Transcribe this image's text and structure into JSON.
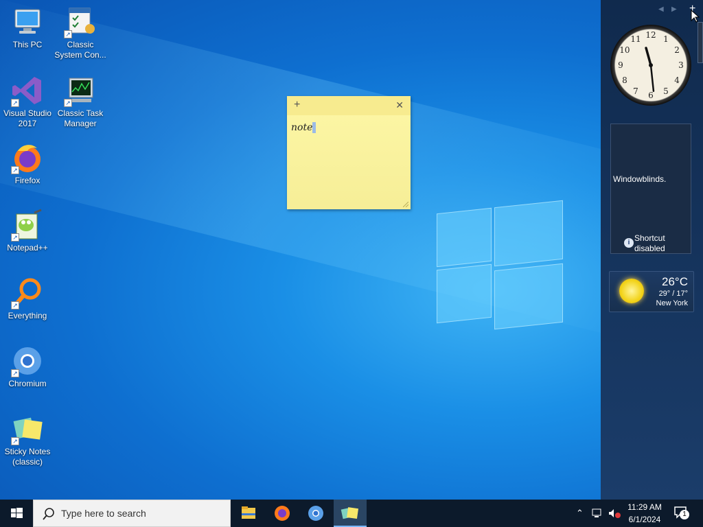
{
  "desktop": {
    "icons": [
      {
        "label": "This PC",
        "icon": "computer-icon"
      },
      {
        "label": "Classic System Con...",
        "icon": "control-panel-icon"
      },
      {
        "label": "Visual Studio 2017",
        "icon": "visual-studio-icon"
      },
      {
        "label": "Classic Task Manager",
        "icon": "task-manager-icon"
      },
      {
        "label": "Firefox",
        "icon": "firefox-icon"
      },
      {
        "label": "Notepad++",
        "icon": "notepadpp-icon"
      },
      {
        "label": "Everything",
        "icon": "everything-icon"
      },
      {
        "label": "Chromium",
        "icon": "chromium-icon"
      },
      {
        "label": "Sticky Notes (classic)",
        "icon": "sticky-notes-icon"
      }
    ]
  },
  "sticky_note": {
    "add": "+",
    "close": "✕",
    "text": "note"
  },
  "sidebar": {
    "gadget_message": "Windowblinds.",
    "shortcut_status": "Shortcut disabled",
    "clock_numbers": [
      "12",
      "1",
      "2",
      "3",
      "4",
      "5",
      "6",
      "7",
      "8",
      "9",
      "10",
      "11"
    ],
    "weather": {
      "temperature": "26°C",
      "range": "29° / 17°",
      "city": "New York"
    }
  },
  "taskbar": {
    "search_placeholder": "Type here to search",
    "time": "11:29 AM",
    "date": "6/1/2024",
    "notification_count": "1"
  },
  "colors": {
    "taskbar": "#0c1a2b",
    "sticky": "#fdf7a6",
    "accent": "#0e6fd0"
  }
}
